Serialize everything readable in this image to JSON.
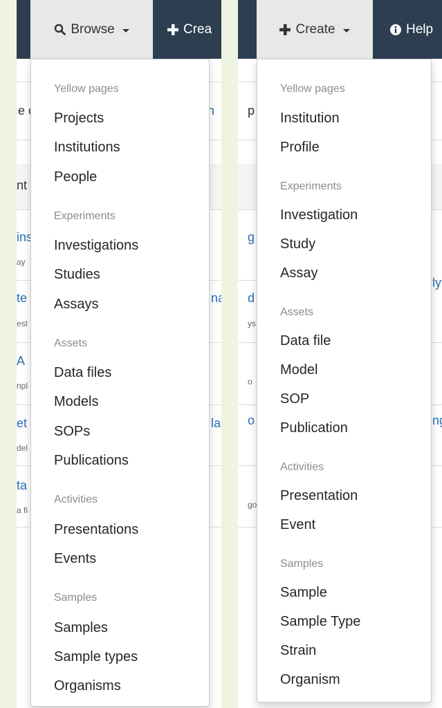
{
  "left": {
    "navbar": {
      "browse_label": "Browse",
      "create_label": "Crea"
    },
    "background": {
      "t1": "e o",
      "t2": "n",
      "t3": "nt",
      "t4": "ins",
      "t5": "ay",
      "t6": "te",
      "t7": "est",
      "t8": "na",
      "t9": "A",
      "t10": "npl",
      "t11": "et",
      "t12": "del",
      "t13": "la",
      "t14": "ta",
      "t15": "a fi"
    },
    "menu": {
      "sections": [
        {
          "header": "Yellow pages",
          "items": [
            "Projects",
            "Institutions",
            "People"
          ]
        },
        {
          "header": "Experiments",
          "items": [
            "Investigations",
            "Studies",
            "Assays"
          ]
        },
        {
          "header": "Assets",
          "items": [
            "Data files",
            "Models",
            "SOPs",
            "Publications"
          ]
        },
        {
          "header": "Activities",
          "items": [
            "Presentations",
            "Events"
          ]
        },
        {
          "header": "Samples",
          "items": [
            "Samples",
            "Sample types",
            "Organisms"
          ]
        }
      ]
    }
  },
  "right": {
    "navbar": {
      "create_label": "Create",
      "help_label": "Help"
    },
    "background": {
      "t1": "p",
      "t2": "g",
      "t3": "d",
      "t4": "ys",
      "t5": "ly",
      "t6": "o",
      "t7": "o",
      "t8": "ng",
      "t9": "go"
    },
    "menu": {
      "sections": [
        {
          "header": "Yellow pages",
          "items": [
            "Institution",
            "Profile"
          ]
        },
        {
          "header": "Experiments",
          "items": [
            "Investigation",
            "Study",
            "Assay"
          ]
        },
        {
          "header": "Assets",
          "items": [
            "Data file",
            "Model",
            "SOP",
            "Publication"
          ]
        },
        {
          "header": "Activities",
          "items": [
            "Presentation",
            "Event"
          ]
        },
        {
          "header": "Samples",
          "items": [
            "Sample",
            "Sample Type",
            "Strain",
            "Organism"
          ]
        }
      ]
    }
  }
}
